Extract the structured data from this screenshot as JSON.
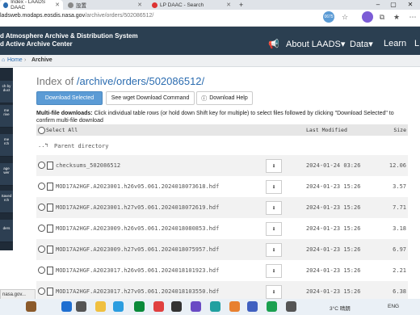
{
  "browser": {
    "tabs": [
      {
        "label": "Index - LAADS DAAC",
        "active": true
      },
      {
        "label": "設置",
        "active": false
      },
      {
        "label": "LP DAAC - Search",
        "active": false
      }
    ],
    "new_tab": "+",
    "window_controls": [
      "–",
      "▢",
      "✕"
    ],
    "url_host": "ladsweb.modaps.eosdis.nasa.gov",
    "url_path": "/archive/orders/502086512/",
    "extension_badge": "0675"
  },
  "site": {
    "title_line1": "d Atmosphere Archive & Distribution System",
    "title_line2": "d Active Archive Center",
    "nav": [
      "About LAADS",
      "Data",
      "Learn",
      "L"
    ]
  },
  "breadcrumb": {
    "home": "Home",
    "sep": "›",
    "current": "Archive"
  },
  "sidebar": [
    "ch by\nduct",
    "me\nrive",
    "me\nrch",
    "age\nwer",
    "Saved\nrch",
    "ders"
  ],
  "main": {
    "index_prefix": "Index of ",
    "index_path": "/archive/orders/502086512/",
    "buttons": {
      "download_selected": "Download Selected",
      "wget": "See wget Download Command",
      "help": "Download Help"
    },
    "desc_bold": "Multi-file downloads:",
    "desc_text": "Click individual table rows (or hold down Shift key for multiple) to select files followed by clicking \"Download Selected\" to confirm multi-file download",
    "headers": {
      "select": "Select All",
      "modified": "Last Modified",
      "size": "Size"
    },
    "parent": "Parent directory",
    "rows": [
      {
        "name": "checksums_502086512",
        "date": "2024-01-24 03:26",
        "size": "12.06"
      },
      {
        "name": "MOD17A2HGF.A2023001.h26v05.061.2024018073618.hdf",
        "date": "2024-01-23 15:26",
        "size": "3.57"
      },
      {
        "name": "MOD17A2HGF.A2023001.h27v05.061.2024018072619.hdf",
        "date": "2024-01-23 15:26",
        "size": "7.71"
      },
      {
        "name": "MOD17A2HGF.A2023009.h26v05.061.2024018080853.hdf",
        "date": "2024-01-23 15:26",
        "size": "3.18"
      },
      {
        "name": "MOD17A2HGF.A2023009.h27v05.061.2024018075957.hdf",
        "date": "2024-01-23 15:26",
        "size": "6.97"
      },
      {
        "name": "MOD17A2HGF.A2023017.h26v05.061.2024018101923.hdf",
        "date": "2024-01-23 15:26",
        "size": "2.21"
      },
      {
        "name": "MOD17A2HGF.A2023017.h27v05.061.2024018103550.hdf",
        "date": "2024-01-23 15:26",
        "size": "6.38"
      }
    ]
  },
  "status_url": "nasa.gov...",
  "taskbar": {
    "weather": "3°C 晴朗",
    "lang": "ENG"
  }
}
